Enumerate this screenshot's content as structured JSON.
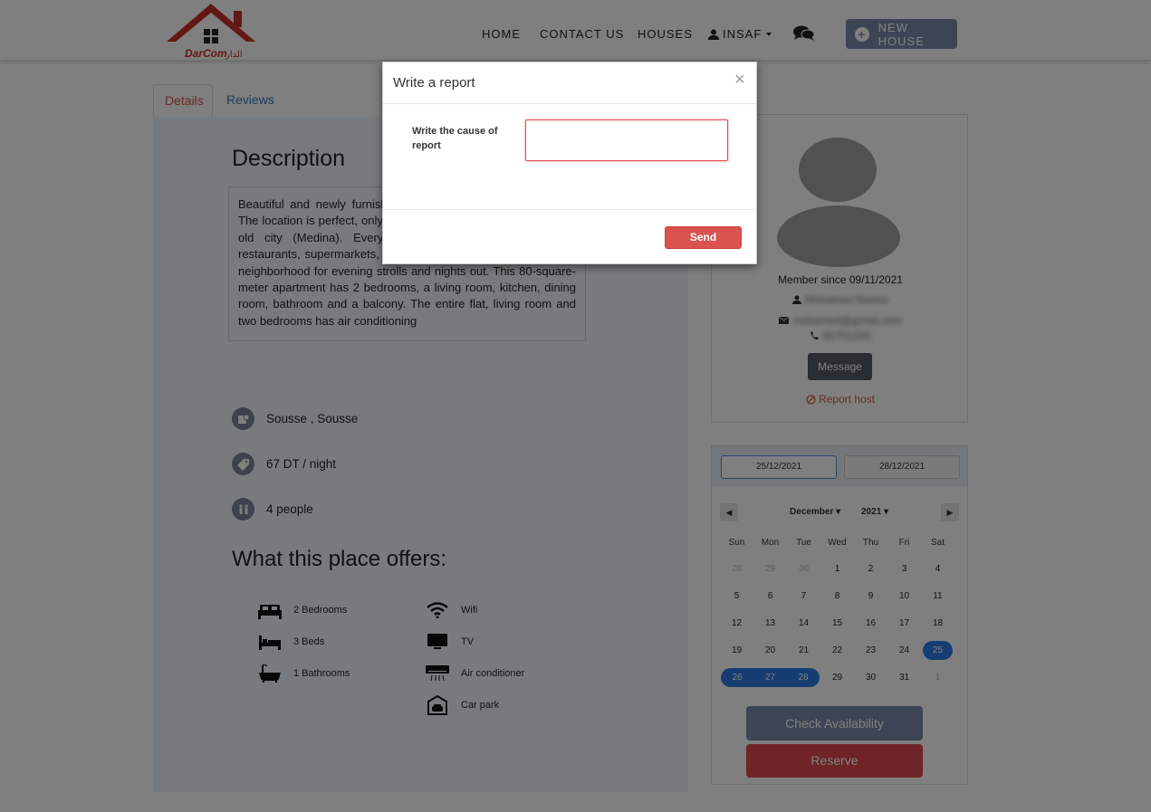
{
  "nav": {
    "logo_text": "DarCom الدار",
    "home": "HOME",
    "contact": "CONTACT US",
    "houses": "HOUSES",
    "user": "INSAF",
    "new_house": "NEW HOUSE"
  },
  "tabs": {
    "details": "Details",
    "reviews": "Reviews"
  },
  "details": {
    "title": "Description",
    "description": "Beautiful and newly furnished apartment, close to the beach. The location is perfect, only few minutes from the beach and the old city (Medina). Everything is within walking including restaurants, supermarkets, shops, cafes, beach and souk. Safe neighborhood for evening strolls and nights out. This 80-square-meter apartment has 2 bedrooms, a living room, kitchen, dining room, bathroom and a balcony. The entire flat, living room and two bedrooms has air conditioning",
    "location": "Sousse , Sousse",
    "price": "67 DT / night",
    "people": "4 people",
    "offers_title": "What this place offers:",
    "amenities_left": [
      {
        "label": "2 Bedrooms",
        "icon": "double-bed-icon"
      },
      {
        "label": "3 Beds",
        "icon": "bed-icon"
      },
      {
        "label": "1 Bathrooms",
        "icon": "bathtub-icon"
      }
    ],
    "amenities_right": [
      {
        "label": "Wifi",
        "icon": "wifi-icon"
      },
      {
        "label": "TV",
        "icon": "tv-icon"
      },
      {
        "label": "Air conditioner",
        "icon": "air-conditioner-icon"
      },
      {
        "label": "Car park",
        "icon": "garage-icon"
      }
    ]
  },
  "host": {
    "member_since": "Member since 09/11/2021",
    "name": "Mohamed Nooria",
    "email": "mohamed@gmail.com",
    "phone": "92751255",
    "message": "Message",
    "report": "Report host"
  },
  "booking": {
    "start_date": "25/12/2021",
    "end_date": "28/12/2021",
    "month": "December",
    "year": "2021",
    "weekdays": [
      "Sun",
      "Mon",
      "Tue",
      "Wed",
      "Thu",
      "Fri",
      "Sat"
    ],
    "weeks": [
      [
        "28",
        "29",
        "30",
        "1",
        "2",
        "3",
        "4"
      ],
      [
        "5",
        "6",
        "7",
        "8",
        "9",
        "10",
        "11"
      ],
      [
        "12",
        "13",
        "14",
        "15",
        "16",
        "17",
        "18"
      ],
      [
        "19",
        "20",
        "21",
        "22",
        "23",
        "24",
        "25"
      ],
      [
        "26",
        "27",
        "28",
        "29",
        "30",
        "31",
        "1"
      ]
    ],
    "check_availability": "Check Availability",
    "reserve": "Reserve"
  },
  "modal": {
    "title": "Write a report",
    "close": "×",
    "label": "Write the cause of report",
    "textarea_value": "",
    "send": "Send"
  },
  "colors": {
    "accent_blue": "#2a7ae2",
    "danger": "#d9534f",
    "primary_muted": "#7b8aab"
  }
}
